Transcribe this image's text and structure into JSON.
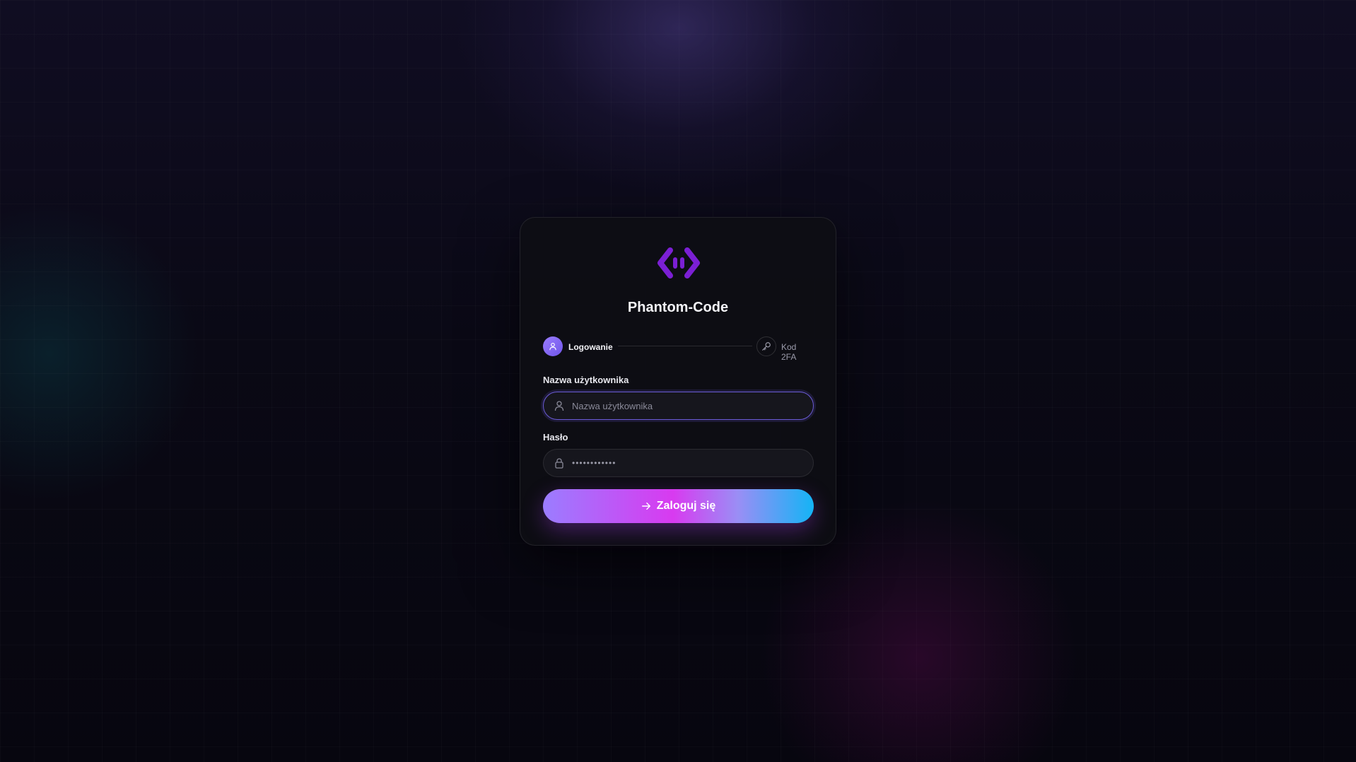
{
  "app": {
    "title": "Phantom-Code",
    "logo_icon": "code-brackets-logo",
    "brand_color": "#7b1fd4"
  },
  "steps": [
    {
      "label": "Logowanie",
      "icon": "user-icon",
      "active": true
    },
    {
      "label": "Kod 2FA",
      "icon": "key-icon",
      "active": false
    }
  ],
  "form": {
    "username": {
      "label": "Nazwa użytkownika",
      "placeholder": "Nazwa użytkownika",
      "value": "",
      "icon": "user-icon"
    },
    "password": {
      "label": "Hasło",
      "masked_value": "••••••••••••",
      "icon": "lock-icon"
    },
    "submit": {
      "label": "Zaloguj się",
      "icon": "arrow-right-icon"
    }
  },
  "colors": {
    "accent": "#6b5bd6",
    "button_gradient": [
      "#9b7dff",
      "#d83af0",
      "#9a8ef5",
      "#14b4f5"
    ]
  }
}
